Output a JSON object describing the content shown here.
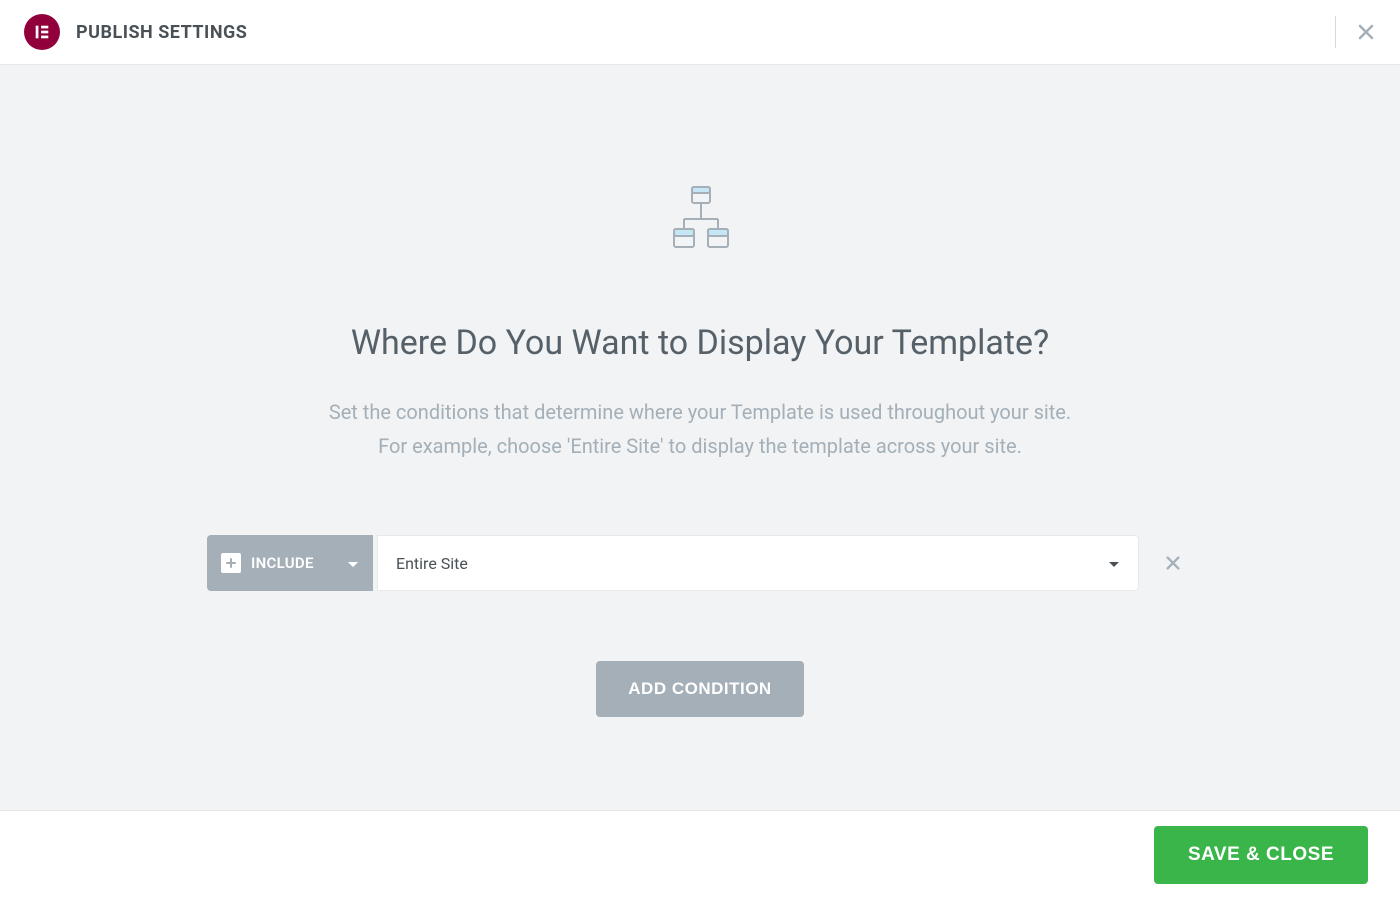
{
  "header": {
    "title": "PUBLISH SETTINGS"
  },
  "main": {
    "heading": "Where Do You Want to Display Your Template?",
    "description_line1": "Set the conditions that determine where your Template is used throughout your site.",
    "description_line2": "For example, choose 'Entire Site' to display the template across your site.",
    "condition": {
      "type_label": "INCLUDE",
      "scope_value": "Entire Site"
    },
    "add_condition_label": "ADD CONDITION"
  },
  "footer": {
    "save_close_label": "SAVE & CLOSE"
  }
}
